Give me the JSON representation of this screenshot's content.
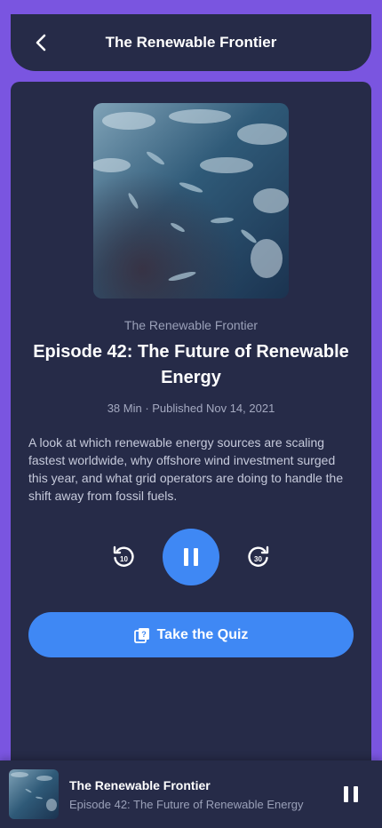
{
  "header": {
    "title": "The Renewable Frontier",
    "back_icon": "chevron-left-icon"
  },
  "episode": {
    "podcast_name": "The Renewable Frontier",
    "title": "Episode 42: The Future of Renewable Energy",
    "meta": "38 Min · Published Nov 14, 2021",
    "description": "A look at which renewable energy sources are scaling fastest worldwide, why offshore wind investment surged this year, and what grid operators are doing to handle the shift away from fossil fuels."
  },
  "controls": {
    "skip_back_label": "10",
    "skip_forward_label": "30",
    "skip_back_icon": "rewind-10-icon",
    "skip_forward_icon": "forward-30-icon",
    "play_state_icon": "pause-icon"
  },
  "quiz": {
    "label": "Take the Quiz",
    "icon": "quiz-icon"
  },
  "mini_player": {
    "title": "The Renewable Frontier",
    "subtitle": "Episode 42: The Future of Renewable Energy",
    "icon": "pause-icon"
  },
  "colors": {
    "background": "#7a55e0",
    "surface": "#262b48",
    "accent": "#3f88f4"
  }
}
